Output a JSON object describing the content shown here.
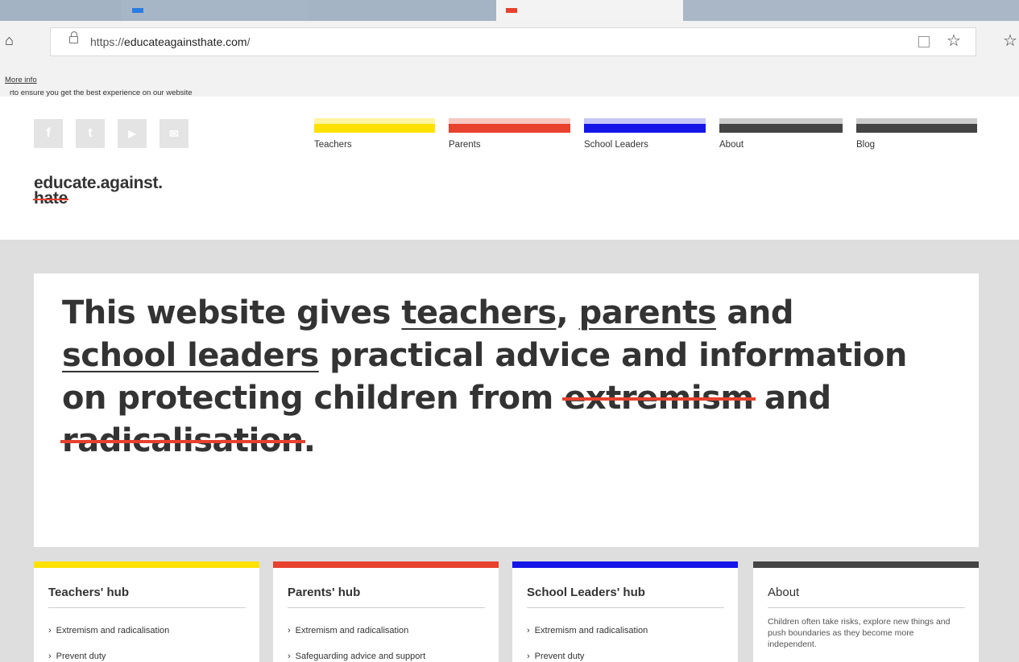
{
  "browser": {
    "url_prefix": "https://",
    "url_domain": "educateagainsthate.com",
    "url_suffix": "/"
  },
  "cookie_banner": {
    "text": "rto ensure you get the best experience on our website",
    "link": "More info"
  },
  "social": [
    {
      "name": "facebook-icon",
      "glyph": "f"
    },
    {
      "name": "twitter-icon",
      "glyph": "t"
    },
    {
      "name": "youtube-icon",
      "glyph": "▶"
    },
    {
      "name": "email-icon",
      "glyph": "✉"
    }
  ],
  "nav": {
    "items": [
      {
        "label": "Teachers",
        "color": "#ffe100",
        "light": "#fff4a0"
      },
      {
        "label": "Parents",
        "color": "#e8412e",
        "light": "#f7c7c0"
      },
      {
        "label": "School Leaders",
        "color": "#1515e8",
        "light": "#c6c6f7"
      },
      {
        "label": "About",
        "color": "#444444",
        "light": "#cccccc"
      },
      {
        "label": "Blog",
        "color": "#444444",
        "light": "#cccccc"
      }
    ]
  },
  "logo": {
    "line1": "educate.against.",
    "line2": "hate"
  },
  "hero": {
    "t1": "This website gives ",
    "link_teachers": "teachers",
    "t2": ", ",
    "link_parents": "parents",
    "t3": " and ",
    "link_school_leaders": "school leaders",
    "t4": " practical advice and information on protecting children from ",
    "strike_extremism": "extremism",
    "t5": " and ",
    "strike_radicalisation": "radicalisation",
    "t6": "."
  },
  "cards": [
    {
      "title": "Teachers' hub",
      "color": "#ffe100",
      "links": [
        "Extremism and radicalisation",
        "Prevent duty"
      ]
    },
    {
      "title": "Parents' hub",
      "color": "#e8412e",
      "links": [
        "Extremism and radicalisation",
        "Safeguarding advice and support"
      ]
    },
    {
      "title": "School Leaders' hub",
      "color": "#1515e8",
      "links": [
        "Extremism and radicalisation",
        "Prevent duty"
      ]
    },
    {
      "title": "About",
      "color": "#444444",
      "description": "Children often take risks, explore new things and push boundaries as they become more independent."
    }
  ],
  "colors": {
    "strike_red": "#e8412e",
    "hero_background": "#dedede"
  }
}
